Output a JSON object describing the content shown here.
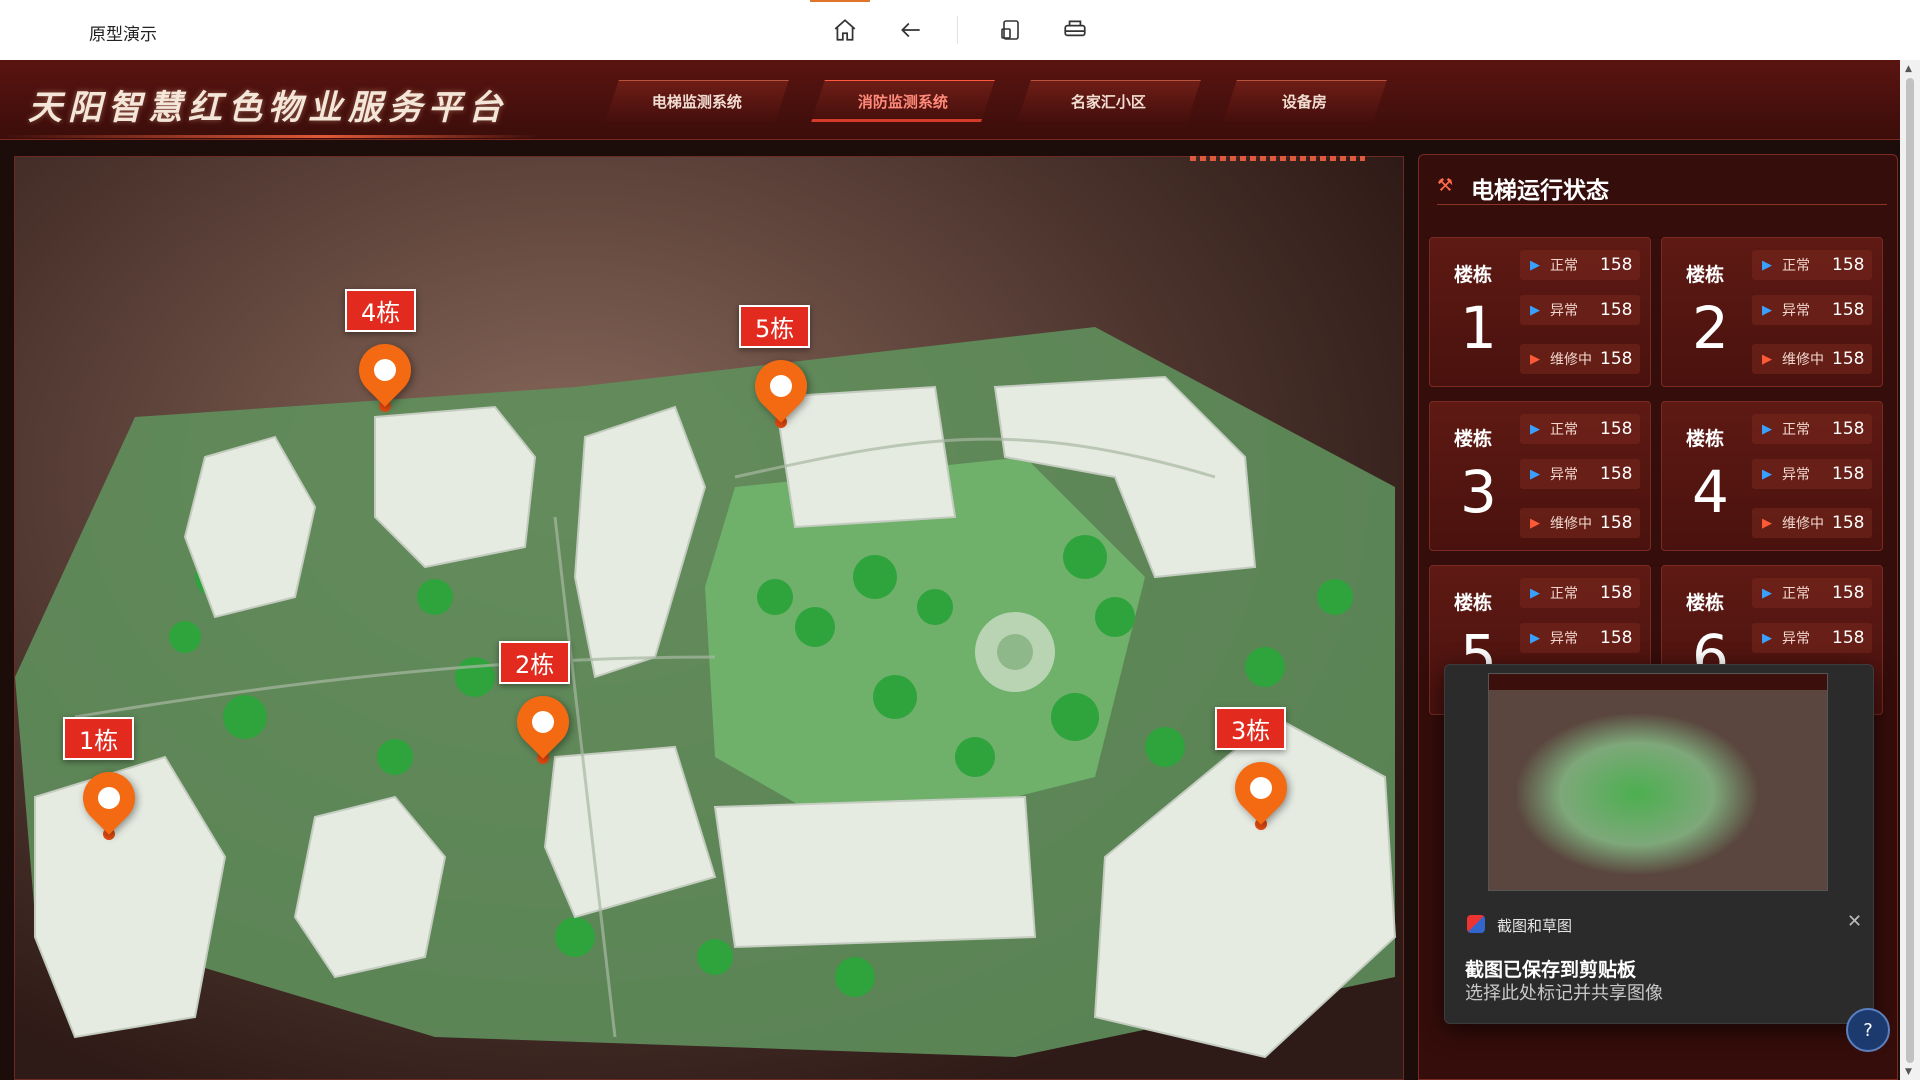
{
  "browser": {
    "title": "原型演示",
    "icons": [
      "home-icon",
      "back-arrow-icon",
      "device-icon",
      "print-icon"
    ]
  },
  "app": {
    "brand": "天阳智慧红色物业服务平台",
    "nav": [
      {
        "label": "电梯监测系统",
        "active": false
      },
      {
        "label": "消防监测系统",
        "active": true
      },
      {
        "label": "名家汇小区",
        "active": false
      },
      {
        "label": "设备房",
        "active": false
      }
    ]
  },
  "map": {
    "pins": [
      {
        "label": "4栋"
      },
      {
        "label": "5栋"
      },
      {
        "label": "2栋"
      },
      {
        "label": "1栋"
      },
      {
        "label": "3栋"
      }
    ]
  },
  "panel": {
    "title": "电梯运行状态",
    "building_label": "楼栋",
    "status_labels": {
      "normal": "正常",
      "abnormal": "异常",
      "repair": "维修中"
    },
    "cards": [
      {
        "num": "1",
        "normal": "158",
        "abnormal": "158",
        "repair": "158"
      },
      {
        "num": "2",
        "normal": "158",
        "abnormal": "158",
        "repair": "158"
      },
      {
        "num": "3",
        "normal": "158",
        "abnormal": "158",
        "repair": "158"
      },
      {
        "num": "4",
        "normal": "158",
        "abnormal": "158",
        "repair": "158"
      },
      {
        "num": "5",
        "normal": "158",
        "abnormal": "158"
      },
      {
        "num": "6",
        "normal": "158",
        "abnormal": "158"
      }
    ],
    "colors": {
      "normal": "#3aa0ff",
      "repair": "#ff5a36"
    }
  },
  "toast": {
    "app_name": "截图和草图",
    "heading": "截图已保存到剪贴板",
    "subtext": "选择此处标记并共享图像"
  },
  "help": {
    "label": "?"
  }
}
